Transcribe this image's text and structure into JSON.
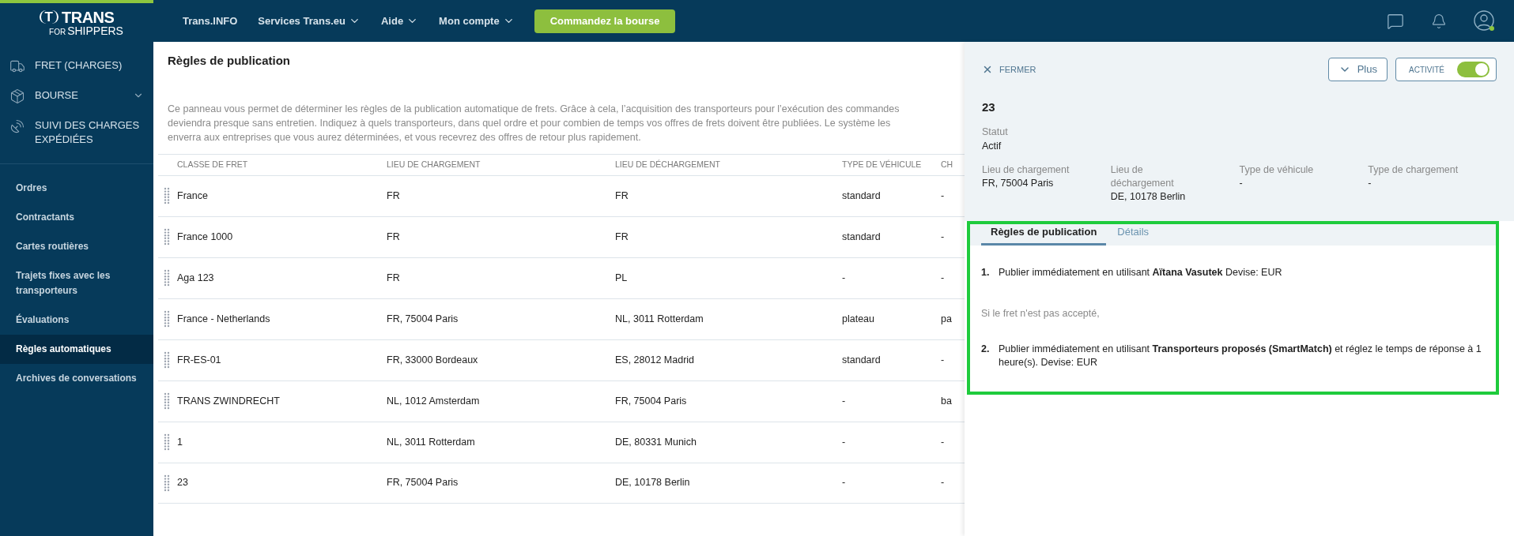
{
  "logo": {
    "mark": "T",
    "name": "TRANS",
    "tagline_small": "FOR",
    "tagline": "SHIPPERS"
  },
  "top_nav": [
    {
      "label": "Trans.INFO",
      "dropdown": false
    },
    {
      "label": "Services Trans.eu",
      "dropdown": true
    },
    {
      "label": "Aide",
      "dropdown": true
    },
    {
      "label": "Mon compte",
      "dropdown": true
    }
  ],
  "cta_button": "Commandez la bourse",
  "sidebar": {
    "main_items": [
      {
        "label": "FRET (CHARGES)",
        "expandable": false
      },
      {
        "label": "BOURSE",
        "expandable": true
      },
      {
        "label": "SUIVI DES CHARGES EXPÉDIÉES",
        "expandable": false
      }
    ],
    "items": [
      {
        "label": "Ordres",
        "selected": false
      },
      {
        "label": "Contractants",
        "selected": false
      },
      {
        "label": "Cartes routières",
        "selected": false
      },
      {
        "label": "Trajets fixes avec les transporteurs",
        "selected": false
      },
      {
        "label": "Évaluations",
        "selected": false
      },
      {
        "label": "Règles automatiques",
        "selected": true
      },
      {
        "label": "Archives de conversations",
        "selected": false
      }
    ]
  },
  "page": {
    "title": "Règles de publication",
    "description": "Ce panneau vous permet de déterminer les règles de la publication automatique de frets. Grâce à cela, l’acquisition des transporteurs pour l’exécution des commandes deviendra presque sans entretien. Indiquez à quels transporteurs, dans quel ordre et pour combien de temps vos offres de frets doivent être publiées. Le système les enverra aux entreprises que vous aurez déterminées, et vous recevrez des offres de retour plus rapidement."
  },
  "table": {
    "columns": [
      "CLASSE DE FRET",
      "LIEU DE CHARGEMENT",
      "LIEU DE DÉCHARGEMENT",
      "TYPE DE VÉHICULE",
      "CH"
    ],
    "rows": [
      [
        "France",
        "FR",
        "FR",
        "standard",
        "-"
      ],
      [
        "France 1000",
        "FR",
        "FR",
        "standard",
        "-"
      ],
      [
        "Aga 123",
        "FR",
        "PL",
        "-",
        "-"
      ],
      [
        "France - Netherlands",
        "FR, 75004 Paris",
        "NL, 3011 Rotterdam",
        "plateau",
        "pa"
      ],
      [
        "FR-ES-01",
        "FR, 33000 Bordeaux",
        "ES, 28012 Madrid",
        "standard",
        "-"
      ],
      [
        "TRANS ZWINDRECHT",
        "NL, 1012 Amsterdam",
        "FR, 75004 Paris",
        "-",
        "ba"
      ],
      [
        "1",
        "NL, 3011 Rotterdam",
        "DE, 80331 Munich",
        "-",
        "-"
      ],
      [
        "23",
        "FR, 75004 Paris",
        "DE, 10178 Berlin",
        "-",
        "-"
      ]
    ]
  },
  "detail_panel": {
    "close_label": "FERMER",
    "more_button": "Plus",
    "activity": {
      "label": "ACTIVITÉ",
      "on": true
    },
    "title": "23",
    "status": {
      "label": "Statut",
      "value": "Actif"
    },
    "fields": [
      {
        "label": "Lieu de chargement",
        "value": "FR, 75004 Paris"
      },
      {
        "label": "Lieu de déchargement",
        "value": "DE, 10178 Berlin"
      },
      {
        "label": "Type de véhicule",
        "value": "-"
      },
      {
        "label": "Type de chargement",
        "value": "-"
      }
    ],
    "tabs": [
      {
        "label": "Règles de publication",
        "selected": true
      },
      {
        "label": "Détails",
        "selected": false
      }
    ],
    "rules": [
      {
        "kind": "rule",
        "number": "1.",
        "text": "Publier immédiatement en utilisant **Aïtana Vasutek** Devise: EUR"
      },
      {
        "kind": "note",
        "text": "Si le fret n'est pas accepté,"
      },
      {
        "kind": "rule",
        "number": "2.",
        "text": "Publier immédiatement en utilisant **Transporteurs proposés (SmartMatch)** et réglez le temps de réponse à 1 heure(s). Devise: EUR"
      }
    ]
  }
}
